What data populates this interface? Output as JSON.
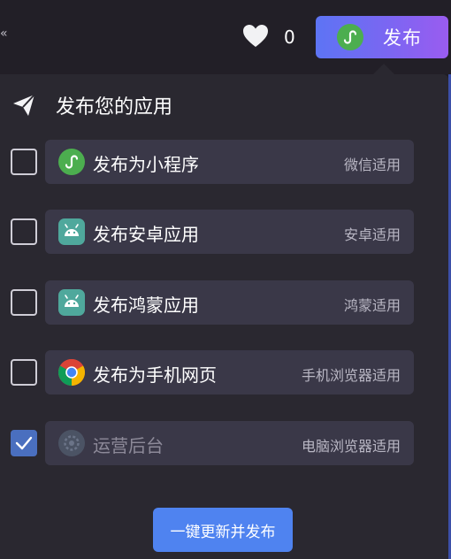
{
  "topbar": {
    "edge_glyph": "«",
    "like_count": "0",
    "publish_label": "发布"
  },
  "panel": {
    "title": "发布您的应用",
    "options": [
      {
        "label": "发布为小程序",
        "hint": "微信适用",
        "icon": "mini-program-icon",
        "checked": false,
        "disabled": false
      },
      {
        "label": "发布安卓应用",
        "hint": "安卓适用",
        "icon": "android-icon",
        "checked": false,
        "disabled": false
      },
      {
        "label": "发布鸿蒙应用",
        "hint": "鸿蒙适用",
        "icon": "android-icon",
        "checked": false,
        "disabled": false
      },
      {
        "label": "发布为手机网页",
        "hint": "手机浏览器适用",
        "icon": "chrome-icon",
        "checked": false,
        "disabled": false
      },
      {
        "label": "运营后台",
        "hint": "电脑浏览器适用",
        "icon": "gear-icon",
        "checked": true,
        "disabled": true
      }
    ],
    "update_button_label": "一键更新并发布"
  },
  "colors": {
    "accent_start": "#5d74f4",
    "accent_end": "#9a5cf0",
    "button_blue": "#4f83f0",
    "checkbox_checked": "#4a6fbf",
    "mini_program_green": "#4cae4f",
    "android_teal": "#4fa89c",
    "panel_bg": "#2a2830",
    "card_bg": "#3a3848"
  }
}
